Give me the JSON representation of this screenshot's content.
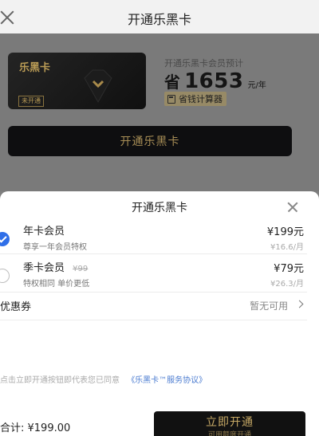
{
  "header": {
    "title": "开通乐黑卡",
    "close_icon": "close-icon"
  },
  "card": {
    "brand": "乐黑卡",
    "status_badge": "未开通",
    "icon": "diamond-icon"
  },
  "savings": {
    "intro": "开通乐黑卡会员预计",
    "prefix": "省",
    "amount": "1653",
    "unit": "元/年",
    "calculator_label": "省钱计算器",
    "calculator_icon": "calculator-icon"
  },
  "open_button_label": "开通乐黑卡",
  "sheet": {
    "title": "开通乐黑卡",
    "close_icon": "close-icon",
    "plans": [
      {
        "name": "年卡会员",
        "original_price": "",
        "description": "尊享一年会员特权",
        "price": "¥199元",
        "monthly": "¥16.6/月",
        "selected": true
      },
      {
        "name": "季卡会员",
        "original_price": "¥99",
        "description": "特权相同 单价更低",
        "price": "¥79元",
        "monthly": "¥26.3/月",
        "selected": false
      }
    ],
    "coupon": {
      "label": "优惠券",
      "value": "暂无可用",
      "chevron_icon": "chevron-right-icon"
    },
    "agreement": {
      "text": "点击立即开通按钮即代表您已同意",
      "link": "《乐黑卡™服务协议》"
    },
    "total": "合计: ¥199.00",
    "pay_button": {
      "label": "立即开通",
      "sub": "可用额度开通"
    }
  },
  "colors": {
    "gold": "#c8aa66",
    "check_blue": "#2f6fe8",
    "link_blue": "#4a7bd0",
    "dark_button": "#111111"
  }
}
